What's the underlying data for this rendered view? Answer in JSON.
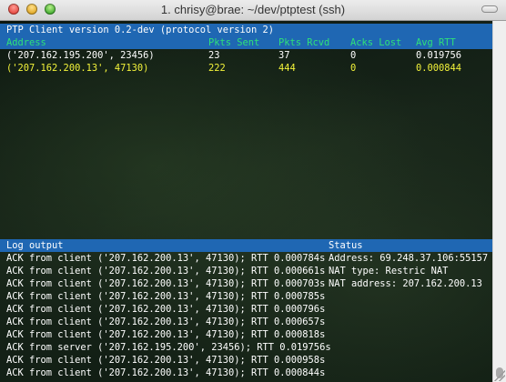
{
  "window": {
    "title": "1. chrisy@brae: ~/dev/ptptest (ssh)"
  },
  "client_header": {
    "title": "PTP Client version 0.2-dev (protocol version 2)"
  },
  "peer_table": {
    "columns": [
      "Address",
      "Pkts Sent",
      "Pkts Rcvd",
      "Acks Lost",
      "Avg RTT"
    ],
    "rows": [
      {
        "address": "('207.162.195.200', 23456)",
        "sent": "23",
        "rcvd": "37",
        "lost": "0",
        "rtt": "0.019756"
      },
      {
        "address": "('207.162.200.13', 47130)",
        "sent": "222",
        "rcvd": "444",
        "lost": "0",
        "rtt": "0.000844"
      }
    ]
  },
  "log": {
    "title": "Log output",
    "lines": [
      "ACK from client ('207.162.200.13', 47130); RTT 0.000784s",
      "ACK from client ('207.162.200.13', 47130); RTT 0.000661s",
      "ACK from client ('207.162.200.13', 47130); RTT 0.000703s",
      "ACK from client ('207.162.200.13', 47130); RTT 0.000785s",
      "ACK from client ('207.162.200.13', 47130); RTT 0.000796s",
      "ACK from client ('207.162.200.13', 47130); RTT 0.000657s",
      "ACK from client ('207.162.200.13', 47130); RTT 0.000818s",
      "ACK from server ('207.162.195.200', 23456); RTT 0.019756s",
      "ACK from client ('207.162.200.13', 47130); RTT 0.000958s",
      "ACK from client ('207.162.200.13', 47130); RTT 0.000844s"
    ]
  },
  "status": {
    "title": "Status",
    "lines": [
      "Address: 69.248.37.106:55157",
      "NAT type: Restric NAT",
      "NAT address: 207.162.200.13"
    ]
  },
  "colors": {
    "header_bar": "#1f67b3",
    "column_header_text": "#2ee07a",
    "highlight_row_text": "#f2f23a",
    "terminal_text": "#ffffff"
  }
}
